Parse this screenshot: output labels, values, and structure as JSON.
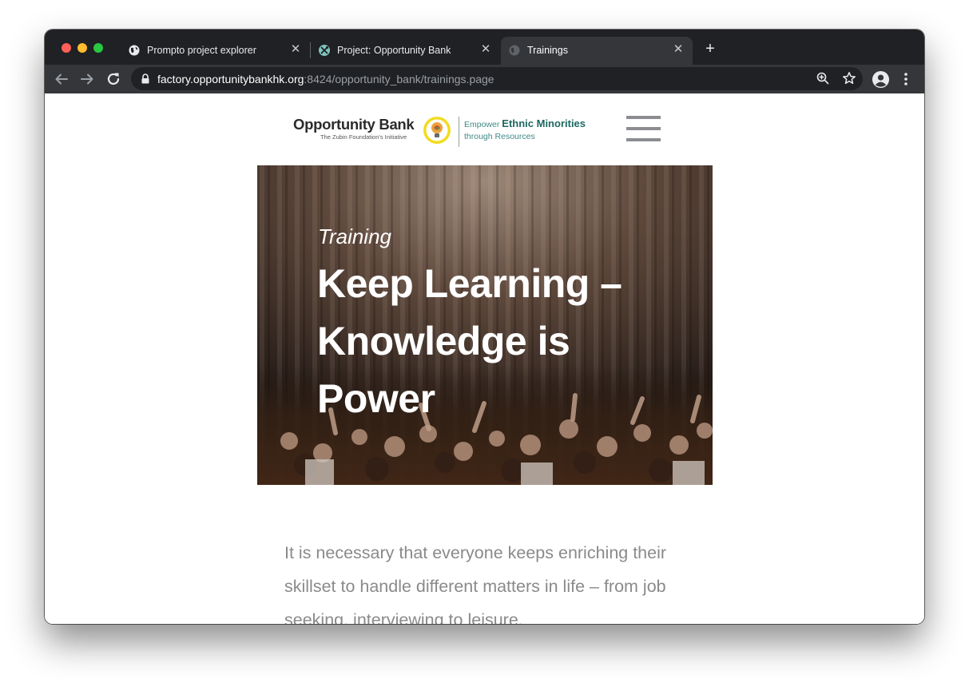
{
  "browser": {
    "tabs": [
      {
        "title": "Prompto project explorer",
        "icon": "globe-icon",
        "active": false
      },
      {
        "title": "Project: Opportunity Bank",
        "icon": "project-tools-icon",
        "active": false
      },
      {
        "title": "Trainings",
        "icon": "globe-icon",
        "active": true
      }
    ],
    "url": {
      "host": "factory.opportunitybankhk.org",
      "rest": ":8424/opportunity_bank/trainings.page"
    }
  },
  "site": {
    "logo": {
      "name": "Opportunity Bank",
      "subtitle": "The Zubin Foundation's Initiative",
      "tagline_prefix": "Empower",
      "tagline_highlight": "Ethnic Minorities",
      "tagline_line2": "through Resources"
    },
    "hero": {
      "kicker": "Training",
      "title": "Keep Learning – Knowledge is Power"
    },
    "intro": "It is necessary that everyone keeps enriching their skillset to handle different matters in life – from job seeking, interviewing to leisure."
  },
  "colors": {
    "tabstrip": "#202124",
    "toolbar": "#35363a",
    "brand_teal": "#1e6862",
    "body_text": "#8a8a8a"
  }
}
